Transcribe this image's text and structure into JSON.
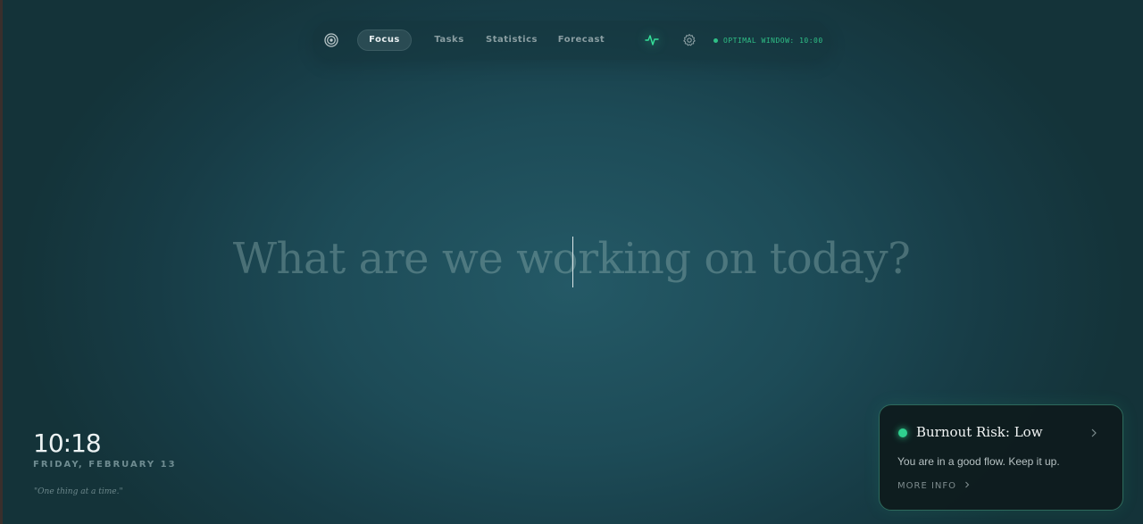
{
  "nav": {
    "logo_icon": "target-icon",
    "tabs": [
      {
        "label": "Focus",
        "active": true
      },
      {
        "label": "Tasks",
        "active": false
      },
      {
        "label": "Statistics",
        "active": false
      },
      {
        "label": "Forecast",
        "active": false
      }
    ],
    "pulse_icon": "activity-icon",
    "settings_icon": "gear-icon",
    "optimal_window": "OPTIMAL WINDOW: 10:00"
  },
  "main": {
    "prompt": "What are we working on today?"
  },
  "clock": {
    "time": "10:18",
    "date": "FRIDAY, FEBRUARY 13",
    "quote": "\"One thing at a time.\""
  },
  "burnout_card": {
    "title": "Burnout Risk: Low",
    "message": "You are in a good flow. Keep it up.",
    "more_info": "MORE INFO",
    "status_color": "#2fcf8e"
  },
  "colors": {
    "accent": "#2fbf86",
    "background": "#1d4b57"
  }
}
